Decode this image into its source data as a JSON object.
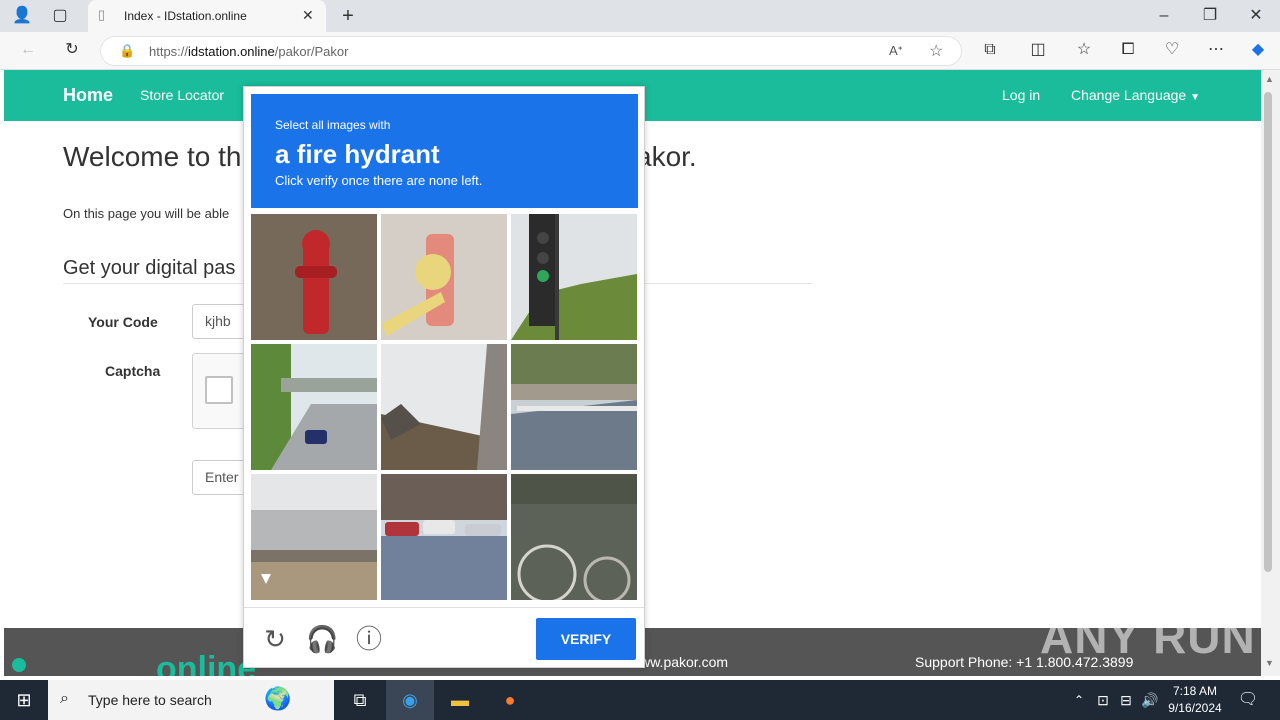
{
  "browser": {
    "tab_title": "Index - IDstation.online",
    "url_prefix": "https://",
    "url_host": "idstation.online",
    "url_path": "/pakor/Pakor"
  },
  "navbar": {
    "brand": "Home",
    "store_locator": "Store Locator",
    "login": "Log in",
    "change_language": "Change Language",
    "accent_color": "#1abc9c"
  },
  "page": {
    "welcome_left": "Welcome to th",
    "welcome_right": "akor.",
    "intro": "On this page you will be able",
    "section_title": "Get your digital pas",
    "your_code_label": "Your Code",
    "your_code_value": "kjhb",
    "captcha_label": "Captcha",
    "enter_placeholder": "Enter"
  },
  "footer": {
    "online_text": "online",
    "site": "www.pakor.com",
    "support": "Support Phone: +1 1.800.472.3899"
  },
  "captcha": {
    "instruction_small": "Select all images with",
    "target": "a fire hydrant",
    "instruction_note": "Click verify once there are none left.",
    "verify_label": "VERIFY",
    "accent_color": "#1a73e8",
    "tiles": [
      "fire-hydrant-red",
      "fire-hydrant-faded",
      "traffic-light",
      "highway-overpass",
      "bridge-underside",
      "road-with-barrier",
      "bridge-side",
      "street-with-cars",
      "bicycle-by-fence"
    ]
  },
  "taskbar": {
    "search_placeholder": "Type here to search",
    "time": "7:18 AM",
    "date": "9/16/2024"
  },
  "watermark": "ANY RUN"
}
